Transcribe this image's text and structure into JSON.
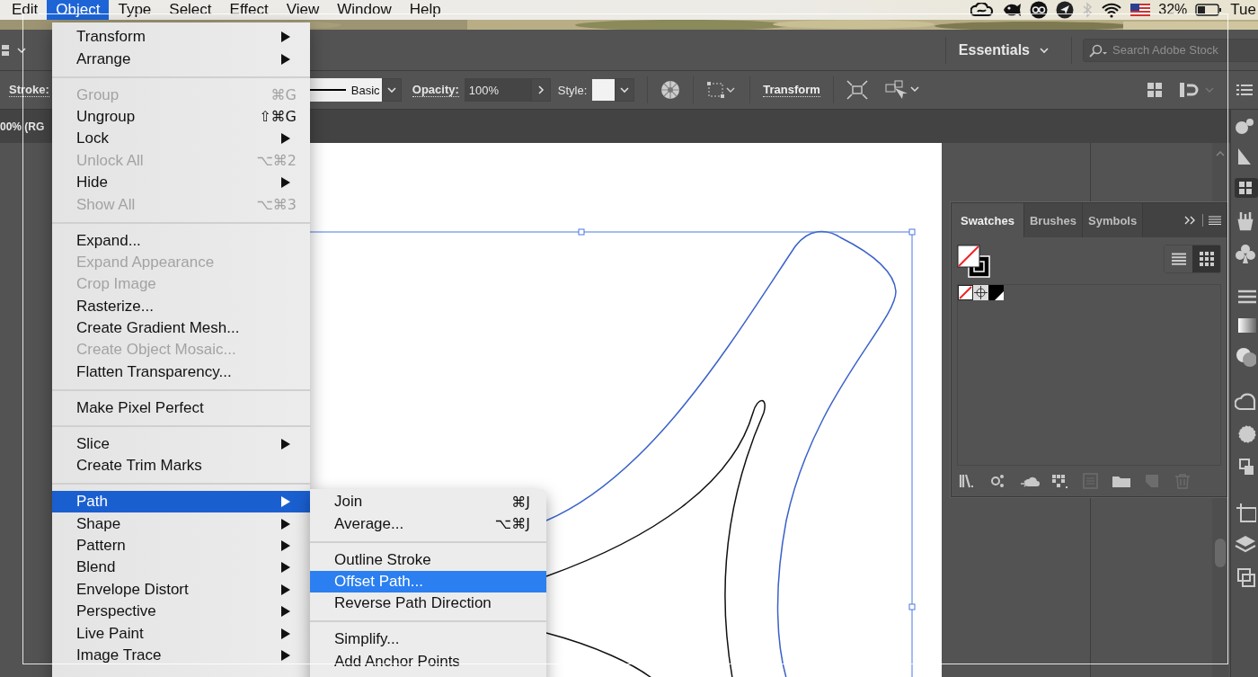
{
  "menu_bar": {
    "items": [
      {
        "label": "Edit",
        "selected": false
      },
      {
        "label": "Object",
        "selected": true
      },
      {
        "label": "Type",
        "selected": false
      },
      {
        "label": "Select",
        "selected": false
      },
      {
        "label": "Effect",
        "selected": false
      },
      {
        "label": "View",
        "selected": false
      },
      {
        "label": "Window",
        "selected": false
      },
      {
        "label": "Help",
        "selected": false
      }
    ],
    "battery_percent": "32%",
    "day": "Tue"
  },
  "app_bar": {
    "workspace": "Essentials",
    "search": {
      "placeholder": "Search Adobe Stock"
    }
  },
  "control_bar": {
    "stroke_label": "Stroke:",
    "brush": "Basic",
    "opacity_label": "Opacity:",
    "opacity": "100%",
    "style_label": "Style:",
    "transform_link": "Transform"
  },
  "document_tab": {
    "title": "00% (RG"
  },
  "object_menu": {
    "groups": [
      [
        {
          "label": "Transform",
          "submenu": true,
          "disabled": false,
          "selected": false
        },
        {
          "label": "Arrange",
          "submenu": true,
          "disabled": false,
          "selected": false
        }
      ],
      [
        {
          "label": "Group",
          "shortcut": "⌘G",
          "submenu": false,
          "disabled": true,
          "selected": false
        },
        {
          "label": "Ungroup",
          "shortcut": "⇧⌘G",
          "submenu": false,
          "disabled": false,
          "selected": false
        },
        {
          "label": "Lock",
          "submenu": true,
          "disabled": false,
          "selected": false
        },
        {
          "label": "Unlock All",
          "shortcut": "⌥⌘2",
          "submenu": false,
          "disabled": true,
          "selected": false
        },
        {
          "label": "Hide",
          "submenu": true,
          "disabled": false,
          "selected": false
        },
        {
          "label": "Show All",
          "shortcut": "⌥⌘3",
          "submenu": false,
          "disabled": true,
          "selected": false
        }
      ],
      [
        {
          "label": "Expand...",
          "submenu": false,
          "disabled": false,
          "selected": false
        },
        {
          "label": "Expand Appearance",
          "submenu": false,
          "disabled": true,
          "selected": false
        },
        {
          "label": "Crop Image",
          "submenu": false,
          "disabled": true,
          "selected": false
        },
        {
          "label": "Rasterize...",
          "submenu": false,
          "disabled": false,
          "selected": false
        },
        {
          "label": "Create Gradient Mesh...",
          "submenu": false,
          "disabled": false,
          "selected": false
        },
        {
          "label": "Create Object Mosaic...",
          "submenu": false,
          "disabled": true,
          "selected": false
        },
        {
          "label": "Flatten Transparency...",
          "submenu": false,
          "disabled": false,
          "selected": false
        }
      ],
      [
        {
          "label": "Make Pixel Perfect",
          "submenu": false,
          "disabled": false,
          "selected": false
        }
      ],
      [
        {
          "label": "Slice",
          "submenu": true,
          "disabled": false,
          "selected": false
        },
        {
          "label": "Create Trim Marks",
          "submenu": false,
          "disabled": false,
          "selected": false
        }
      ],
      [
        {
          "label": "Path",
          "submenu": true,
          "disabled": false,
          "selected": true
        },
        {
          "label": "Shape",
          "submenu": true,
          "disabled": false,
          "selected": false
        },
        {
          "label": "Pattern",
          "submenu": true,
          "disabled": false,
          "selected": false
        },
        {
          "label": "Blend",
          "submenu": true,
          "disabled": false,
          "selected": false
        },
        {
          "label": "Envelope Distort",
          "submenu": true,
          "disabled": false,
          "selected": false
        },
        {
          "label": "Perspective",
          "submenu": true,
          "disabled": false,
          "selected": false
        },
        {
          "label": "Live Paint",
          "submenu": true,
          "disabled": false,
          "selected": false
        },
        {
          "label": "Image Trace",
          "submenu": true,
          "disabled": false,
          "selected": false
        }
      ]
    ]
  },
  "path_submenu": {
    "groups": [
      [
        {
          "label": "Join",
          "shortcut": "⌘J",
          "disabled": false,
          "selected": false
        },
        {
          "label": "Average...",
          "shortcut": "⌥⌘J",
          "disabled": false,
          "selected": false
        }
      ],
      [
        {
          "label": "Outline Stroke",
          "disabled": false,
          "selected": false
        },
        {
          "label": "Offset Path...",
          "disabled": false,
          "selected": true
        },
        {
          "label": "Reverse Path Direction",
          "disabled": false,
          "selected": false
        }
      ],
      [
        {
          "label": "Simplify...",
          "disabled": false,
          "selected": false
        },
        {
          "label": "Add Anchor Points",
          "disabled": false,
          "selected": false
        }
      ]
    ]
  },
  "swatches_panel": {
    "tabs": [
      {
        "label": "Swatches",
        "selected": true
      },
      {
        "label": "Brushes",
        "selected": false
      },
      {
        "label": "Symbols",
        "selected": false
      }
    ],
    "views": [
      {
        "kind": "list",
        "selected": false
      },
      {
        "kind": "grid",
        "selected": true
      }
    ],
    "swatches": [
      {
        "kind": "none"
      },
      {
        "kind": "registration"
      },
      {
        "kind": "black"
      }
    ],
    "footer": [
      {
        "kind": "library",
        "disabled": false
      },
      {
        "kind": "kinds",
        "disabled": false
      },
      {
        "kind": "cloud",
        "disabled": false
      },
      {
        "kind": "group",
        "disabled": false
      },
      {
        "kind": "options",
        "disabled": true
      },
      {
        "kind": "folder",
        "disabled": false
      },
      {
        "kind": "new",
        "disabled": true
      },
      {
        "kind": "trash",
        "disabled": true
      }
    ]
  }
}
